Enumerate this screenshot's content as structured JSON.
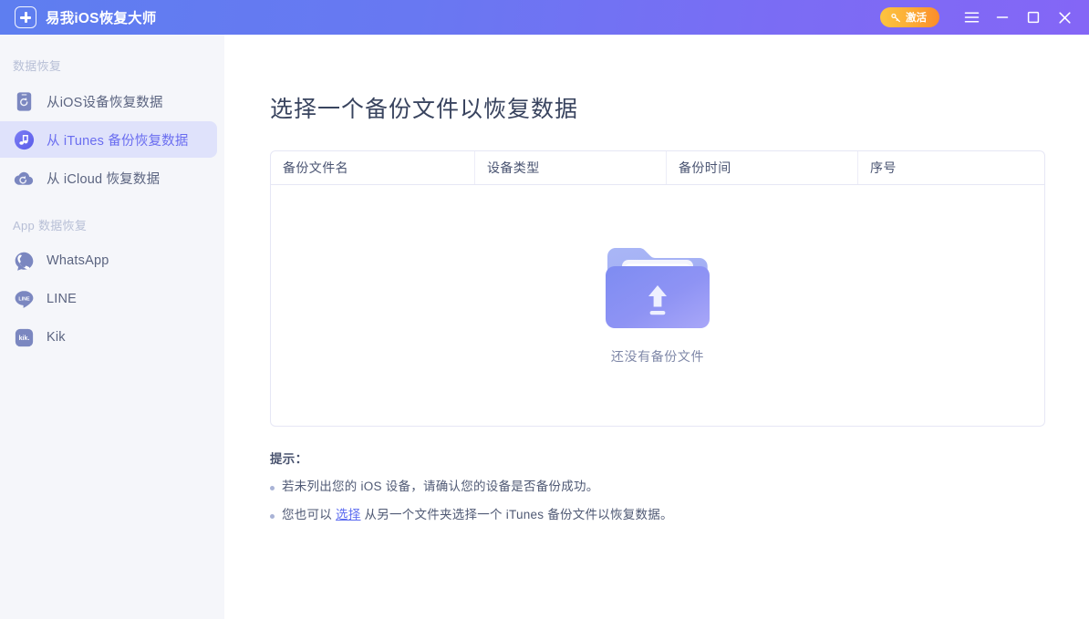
{
  "titlebar": {
    "app_name": "易我iOS恢复大师",
    "logo_icon": "app-logo-plus-icon",
    "activate_label": "激活",
    "activate_icon": "key-icon",
    "activate_gradient_from": "#fdc43f",
    "activate_gradient_to": "#fb8d2a",
    "menu_icon": "hamburger-menu-icon",
    "minimize_icon": "minimize-icon",
    "maximize_icon": "maximize-icon",
    "close_icon": "close-icon",
    "gradient_from": "#5e7ef0",
    "gradient_to": "#8466f6"
  },
  "sidebar": {
    "background": "#f5f6fa",
    "active_background": "#dfe2fb",
    "active_color": "#6b6ef0",
    "sections": [
      {
        "title": "数据恢复",
        "items": [
          {
            "label": "从iOS设备恢复数据",
            "icon": "iphone-restore-icon",
            "active": false
          },
          {
            "label": "从 iTunes 备份恢复数据",
            "icon": "itunes-music-note-icon",
            "active": true
          },
          {
            "label": "从 iCloud 恢复数据",
            "icon": "icloud-restore-icon",
            "active": false
          }
        ]
      },
      {
        "title": "App 数据恢复",
        "items": [
          {
            "label": "WhatsApp",
            "icon": "whatsapp-icon",
            "active": false
          },
          {
            "label": "LINE",
            "icon": "line-icon",
            "active": false
          },
          {
            "label": "Kik",
            "icon": "kik-icon",
            "active": false
          }
        ]
      }
    ]
  },
  "main": {
    "page_title": "选择一个备份文件以恢复数据",
    "table": {
      "headers": [
        "备份文件名",
        "设备类型",
        "备份时间",
        "序号"
      ],
      "rows": [],
      "empty_icon": "empty-folder-upload-icon",
      "empty_text": "还没有备份文件",
      "border_color": "#e6e7f5"
    },
    "tips": {
      "title": "提示：",
      "items": [
        {
          "prefix": "若未列出您的 iOS 设备，请确认您的设备是否备份成功。",
          "link": "",
          "suffix": ""
        },
        {
          "prefix": "您也可以 ",
          "link": "选择",
          "suffix": " 从另一个文件夹选择一个 iTunes 备份文件以恢复数据。"
        }
      ],
      "link_color": "#5b6bf0"
    }
  }
}
